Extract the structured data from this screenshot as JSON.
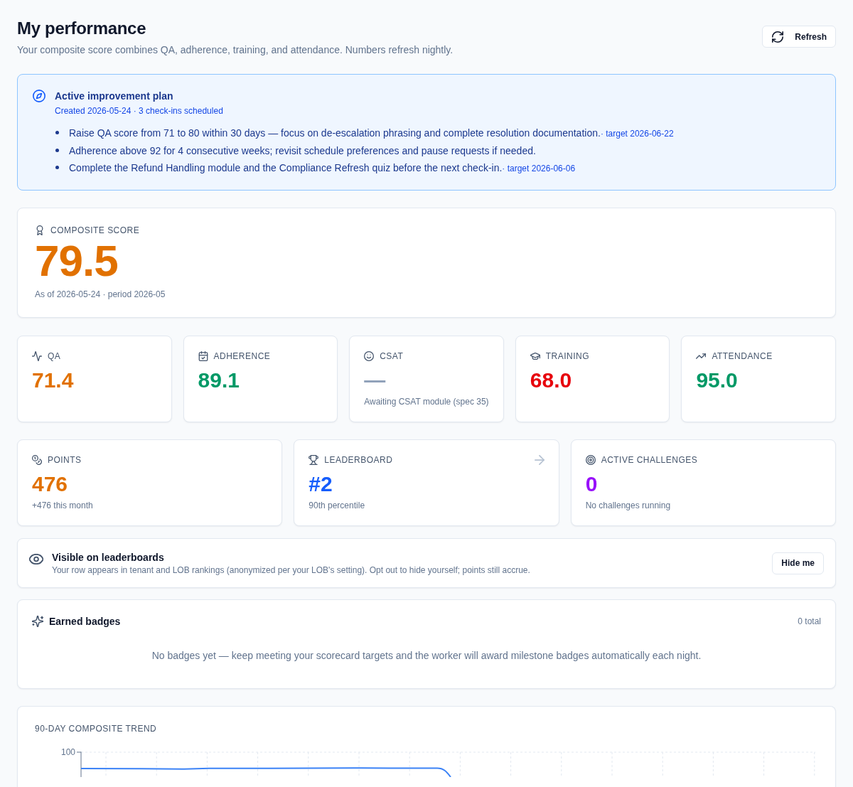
{
  "header": {
    "title": "My performance",
    "subtitle": "Your composite score combines QA, adherence, training, and attendance. Numbers refresh nightly.",
    "refresh_button": "Refresh"
  },
  "improvement_plan": {
    "title": "Active improvement plan",
    "meta": "Created 2026-05-24 · 3 check-ins scheduled",
    "items": [
      {
        "text": "Raise QA score from 71 to 80 within 30 days — focus on de-escalation phrasing and complete resolution documentation.",
        "target": "· target 2026-06-22"
      },
      {
        "text": "Adherence above 92 for 4 consecutive weeks; revisit schedule preferences and pause requests if needed."
      },
      {
        "text": "Complete the Refund Handling module and the Compliance Refresh quiz before the next check-in.",
        "target": "· target 2026-06-06"
      }
    ]
  },
  "composite": {
    "label": "COMPOSITE SCORE",
    "score": "79.5",
    "color": "#e17100",
    "as_of": "As of 2026-05-24 · period 2026-05"
  },
  "metrics": [
    {
      "label": "QA",
      "value": "71.4",
      "color": "#e17100"
    },
    {
      "label": "ADHERENCE",
      "value": "89.1",
      "color": "#009966"
    },
    {
      "label": "CSAT",
      "value": "—",
      "color": "#90a1b9",
      "note": "Awaiting CSAT module (spec 35)"
    },
    {
      "label": "TRAINING",
      "value": "68.0",
      "color": "#e7000b"
    },
    {
      "label": "ATTENDANCE",
      "value": "95.0",
      "color": "#009966"
    }
  ],
  "stats": [
    {
      "label": "POINTS",
      "value": "476",
      "color": "#e17100",
      "note": "+476 this month",
      "link": false
    },
    {
      "label": "LEADERBOARD",
      "value": "#2",
      "color": "#155dfc",
      "note": "90th percentile",
      "link": true
    },
    {
      "label": "ACTIVE CHALLENGES",
      "value": "0",
      "color": "#9810fa",
      "note": "No challenges running",
      "link": false
    }
  ],
  "leaderboard_visibility": {
    "title": "Visible on leaderboards",
    "description": "Your row appears in tenant and LOB rankings (anonymized per your LOB's setting). Opt out to hide yourself; points still accrue.",
    "button": "Hide me"
  },
  "badges": {
    "title": "Earned badges",
    "count": "0 total",
    "empty_message": "No badges yet — keep meeting your scorecard targets and the worker will award milestone badges automatically each night."
  },
  "trend": {
    "title": "90-DAY COMPOSITE TREND",
    "y_tick": "100"
  }
}
